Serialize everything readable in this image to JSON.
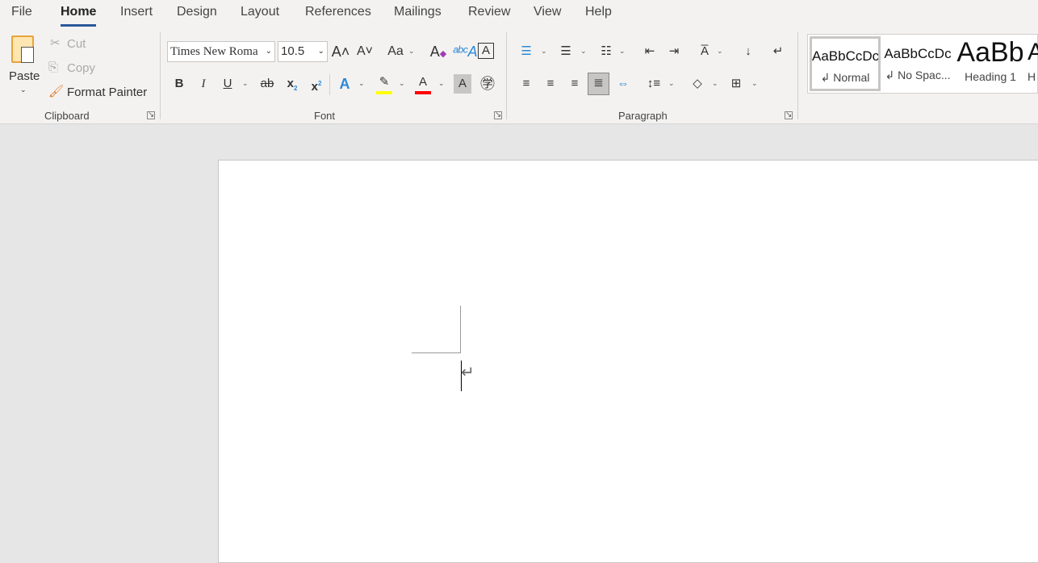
{
  "tabs": [
    "File",
    "Home",
    "Insert",
    "Design",
    "Layout",
    "References",
    "Mailings",
    "Review",
    "View",
    "Help"
  ],
  "active_tab": "Home",
  "clipboard": {
    "paste": "Paste",
    "cut": "Cut",
    "copy": "Copy",
    "format_painter": "Format Painter",
    "group": "Clipboard"
  },
  "font": {
    "name": "Times New Roma",
    "size": "10.5",
    "change_case": "Aa",
    "group": "Font",
    "bold": "B",
    "italic": "I",
    "underline": "U",
    "strike": "ab",
    "sub": "x",
    "sup": "x",
    "text_effects": "A",
    "font_color": "A",
    "shading": "A",
    "highlight_color": "#ffff00",
    "font_color_value": "#ff0000"
  },
  "paragraph": {
    "group": "Paragraph"
  },
  "styles": [
    {
      "preview": "AaBbCcDc",
      "name": "↲ Normal"
    },
    {
      "preview": "AaBbCcDc",
      "name": "↲ No Spac..."
    },
    {
      "preview": "AaBb",
      "name": "Heading 1"
    },
    {
      "preview": "A",
      "name": "H"
    }
  ],
  "document": {
    "paragraph_mark": "↵"
  }
}
